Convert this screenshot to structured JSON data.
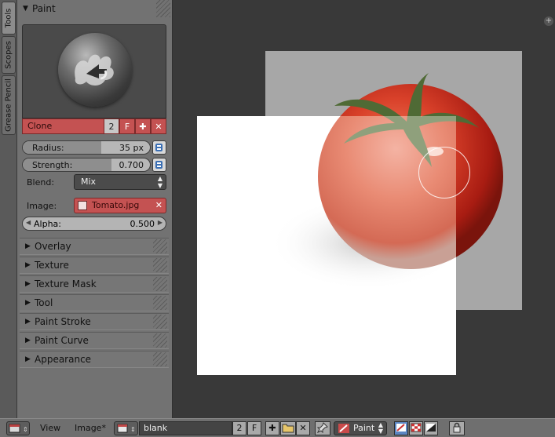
{
  "tabs": [
    "Tools",
    "Scopes",
    "Grease Pencil"
  ],
  "panel": {
    "title": "Paint",
    "brush": {
      "name": "Clone",
      "users": "2",
      "fake_user": "F"
    },
    "radius": {
      "label": "Radius:",
      "value": "35 px",
      "fraction": 0.62
    },
    "strength": {
      "label": "Strength:",
      "value": "0.700",
      "fraction": 0.7
    },
    "blend": {
      "label": "Blend:",
      "value": "Mix"
    },
    "image": {
      "label": "Image:",
      "value": "Tomato.jpg"
    },
    "alpha": {
      "label": "Alpha:",
      "value": "0.500"
    },
    "sections": [
      "Overlay",
      "Texture",
      "Texture Mask",
      "Tool",
      "Paint Stroke",
      "Paint Curve",
      "Appearance"
    ]
  },
  "bottombar": {
    "menus": [
      "View",
      "Image*"
    ],
    "image_name": "blank",
    "users": "2",
    "fake_user": "F",
    "mode": "Paint"
  },
  "colors": {
    "brush_red": "#c45252",
    "panel": "#727272",
    "viewport": "#393939"
  }
}
